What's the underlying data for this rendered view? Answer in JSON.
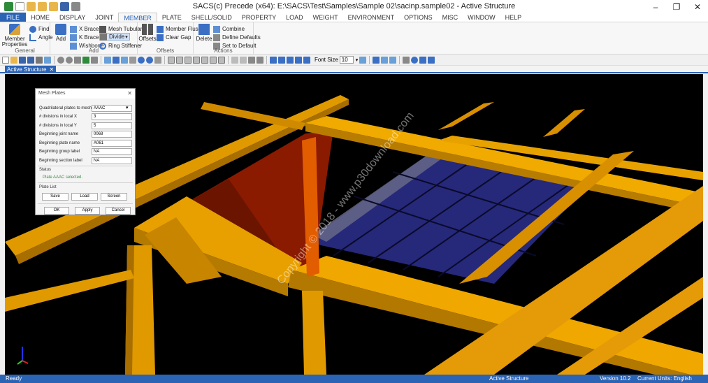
{
  "window": {
    "title": "SACS(c) Precede (x64):  E:\\SACS\\Test\\Samples\\Sample 02\\sacinp.sample02 - Active Structure",
    "minimize": "–",
    "maximize": "❐",
    "close": "✕"
  },
  "menu": {
    "file": "FILE",
    "tabs": [
      "HOME",
      "DISPLAY",
      "JOINT",
      "MEMBER",
      "PLATE",
      "SHELL/SOLID",
      "PROPERTY",
      "LOAD",
      "WEIGHT",
      "ENVIRONMENT",
      "OPTIONS",
      "MISC",
      "WINDOW",
      "HELP"
    ],
    "active_tab": "MEMBER"
  },
  "ribbon": {
    "general": {
      "label": "General",
      "member_properties": "Member Properties",
      "find": "Find",
      "angle": "Angle"
    },
    "add": {
      "label": "Add",
      "add": "Add",
      "x_brace": "X Brace",
      "k_brace": "K Brace",
      "wishbone": "Wishbone",
      "mesh_tubular": "Mesh Tubular",
      "divide": "Divide",
      "ring_stiffener": "Ring Stiffener"
    },
    "offsets": {
      "label": "Offsets",
      "offsets": "Offsets",
      "member_flush": "Member Flush",
      "clear_gap": "Clear Gap"
    },
    "actions": {
      "label": "Actions",
      "delete": "Delete",
      "combine": "Combine",
      "define_defaults": "Define Defaults",
      "set_to_default": "Set to Default"
    }
  },
  "toolbar": {
    "font_size_label": "Font Size",
    "font_size_value": "10"
  },
  "doc_tab": {
    "label": "Active Structure",
    "close": "✕"
  },
  "dialog": {
    "title": "Mesh Plates",
    "close": "✕",
    "fields": [
      {
        "label": "Quadrilateral plates to mesh",
        "value": "AAAC"
      },
      {
        "label": "# divisions in local X",
        "value": "3"
      },
      {
        "label": "# divisions in local Y",
        "value": "5"
      },
      {
        "label": "Beginning joint name",
        "value": "0068"
      },
      {
        "label": "Beginning plate name",
        "value": "A061"
      },
      {
        "label": "Beginning group label",
        "value": "NA"
      },
      {
        "label": "Beginning section label",
        "value": "NA"
      }
    ],
    "status_heading": "Status",
    "status_text": "Plate AAAC selected.",
    "plate_list_heading": "Plate List",
    "save": "Save",
    "load": "Load",
    "screen": "Screen",
    "ok": "OK",
    "apply": "Apply",
    "cancel": "Cancel"
  },
  "watermark": "Copyright © 2018 - www.p30download.com",
  "status": {
    "left": "Ready",
    "mode": "Active Structure",
    "version": "Version 10.2",
    "units": "Current Units: English"
  },
  "colors": {
    "accent": "#2b63b5",
    "steel": "#e59a07",
    "plate": "#26287a",
    "background": "#000000"
  }
}
